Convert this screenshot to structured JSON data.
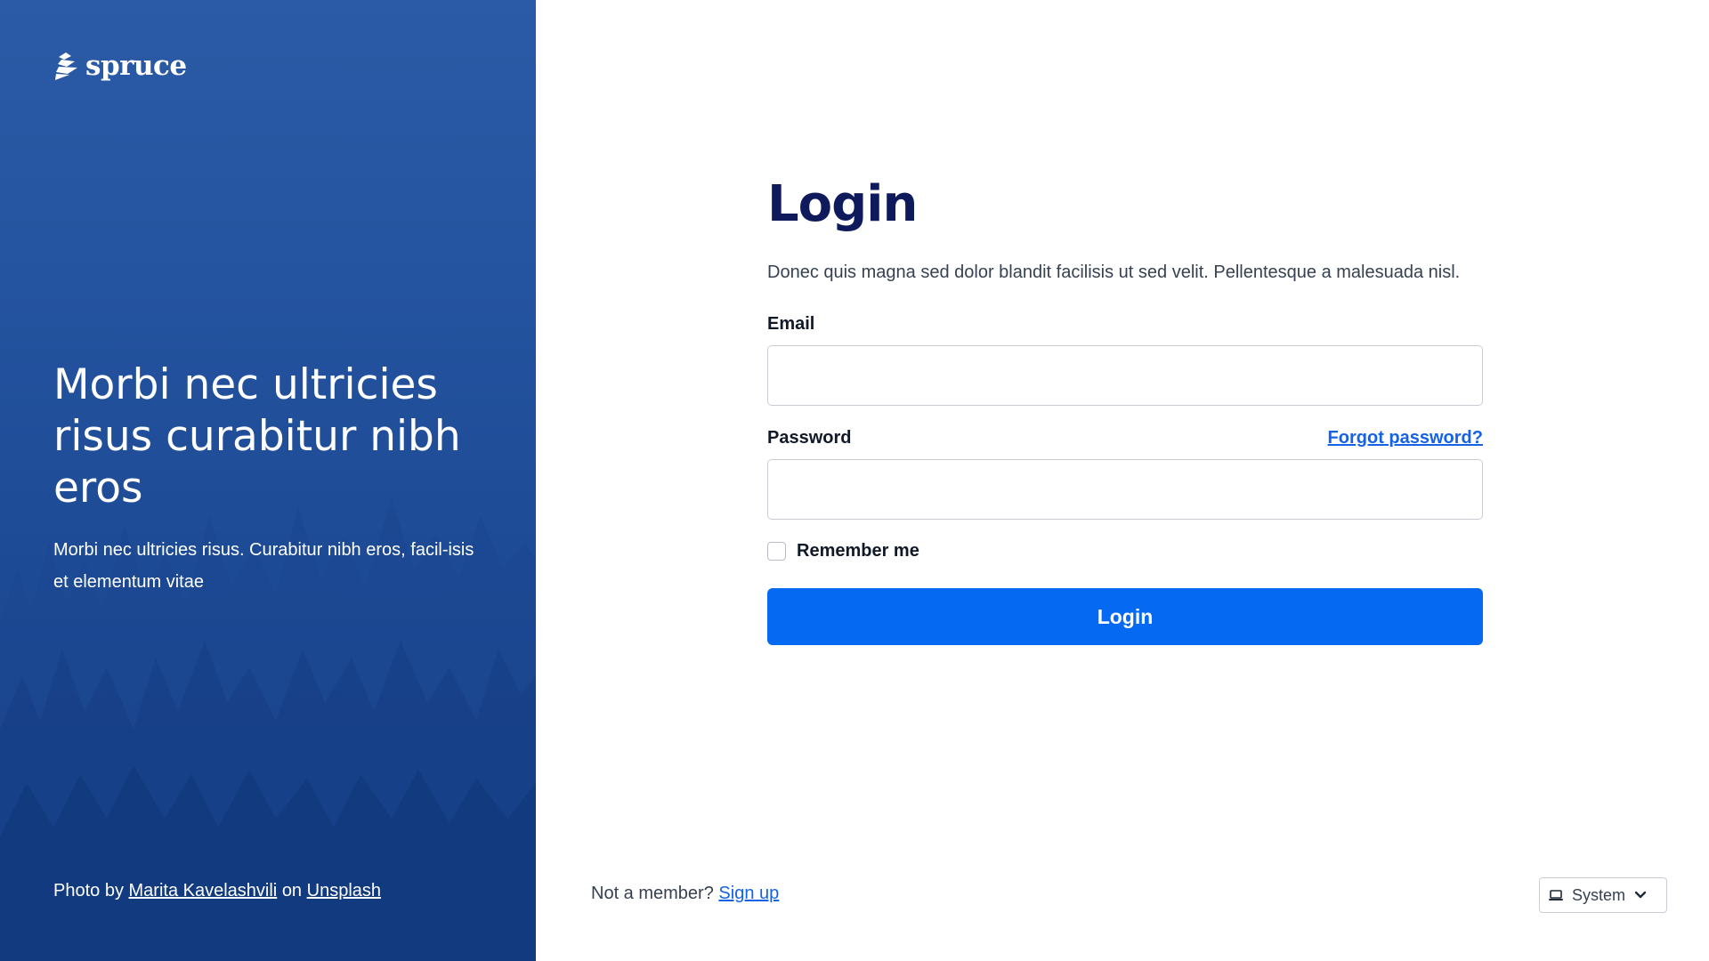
{
  "brand": {
    "name": "spruce"
  },
  "hero": {
    "heading": "Morbi nec ultricies risus curabitur nibh eros",
    "subtext": "Morbi nec ultricies risus. Curabitur nibh eros, facil-isis et elementum vitae",
    "credit_prefix": "Photo by",
    "credit_author": "Marita Kavelashvili",
    "credit_on": "on",
    "credit_site": "Unsplash"
  },
  "form": {
    "title": "Login",
    "intro": "Donec quis magna sed dolor blandit facilisis ut sed velit. Pellentesque a malesuada nisl.",
    "email_label": "Email",
    "email_value": "",
    "password_label": "Password",
    "password_value": "",
    "forgot_label": "Forgot password?",
    "remember_label": "Remember me",
    "remember_checked": false,
    "submit_label": "Login"
  },
  "footer": {
    "signup_prompt": "Not a member?",
    "signup_link": "Sign up",
    "theme_selected": "System"
  },
  "colors": {
    "hero_bg": "#24539f",
    "title": "#0f1a5c",
    "primary": "#0569f1",
    "link": "#1463e6"
  },
  "icons": {
    "logo": "spruce-logo-icon",
    "theme": "laptop-icon",
    "dropdown": "chevron-down-icon"
  }
}
